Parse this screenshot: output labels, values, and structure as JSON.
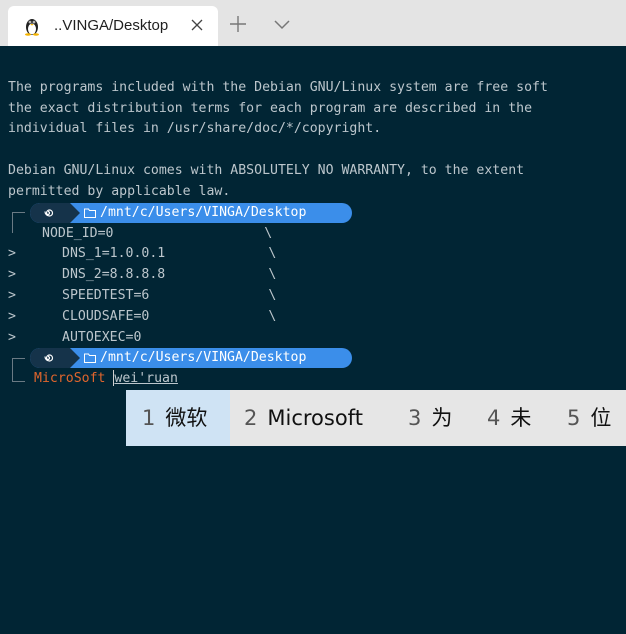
{
  "tab": {
    "title": "..VINGA/Desktop",
    "icon": "linux-penguin-icon"
  },
  "terminal": {
    "motd": [
      "The programs included with the Debian GNU/Linux system are free soft",
      "the exact distribution terms for each program are described in the",
      "individual files in /usr/share/doc/*/copyright.",
      "",
      "Debian GNU/Linux comes with ABSOLUTELY NO WARRANTY, to the extent",
      "permitted by applicable law."
    ],
    "prompt_path": "/mnt/c/Users/VINGA/Desktop",
    "command1": {
      "first": "NODE_ID=0                   \\",
      "continuations": [
        {
          "sym": ">",
          "text": "DNS_1=1.0.0.1             \\"
        },
        {
          "sym": ">",
          "text": "DNS_2=8.8.8.8             \\"
        },
        {
          "sym": ">",
          "text": "SPEEDTEST=6               \\"
        },
        {
          "sym": ">",
          "text": "CLOUDSAFE=0               \\"
        },
        {
          "sym": ">",
          "text": "AUTOEXEC=0"
        }
      ]
    },
    "command2": {
      "typed": "MicroSoft",
      "composition": "wei'ruan"
    }
  },
  "ime": {
    "candidates": [
      {
        "num": "1",
        "text": "微软"
      },
      {
        "num": "2",
        "text": "Microsoft"
      },
      {
        "num": "3",
        "text": "为"
      },
      {
        "num": "4",
        "text": "未"
      },
      {
        "num": "5",
        "text": "位"
      }
    ]
  },
  "colors": {
    "terminal_bg": "#012534",
    "prompt_pill": "#3b8eea",
    "typed_text": "#e0652d",
    "ime_selected": "#cfe3f4"
  }
}
